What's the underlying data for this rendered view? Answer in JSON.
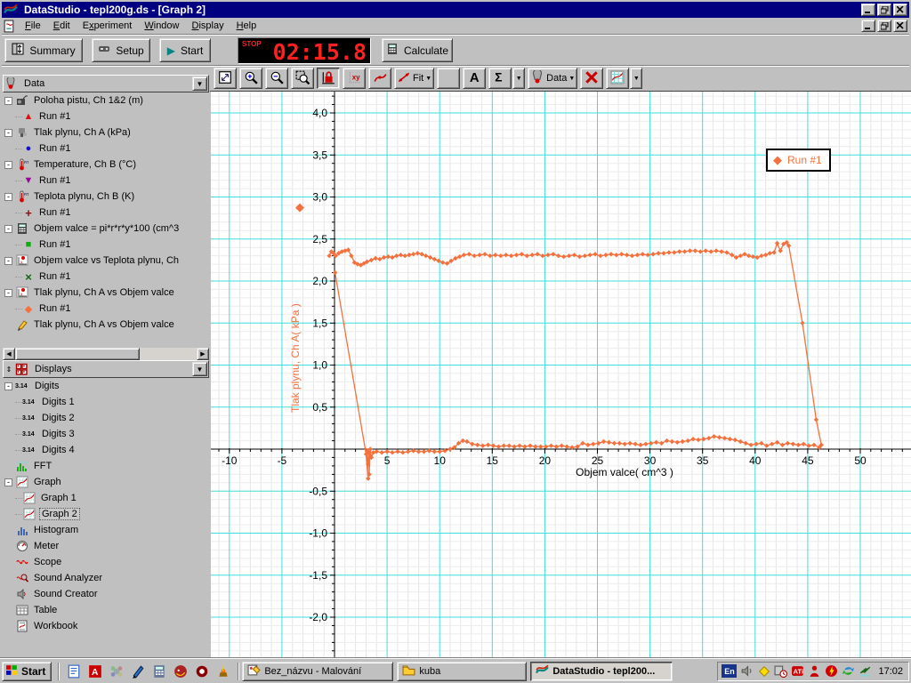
{
  "window": {
    "title": "DataStudio - tepl200g.ds - [Graph 2]"
  },
  "menu": {
    "items": [
      {
        "label": "File",
        "u": 0
      },
      {
        "label": "Edit",
        "u": 0
      },
      {
        "label": "Experiment",
        "u": 1
      },
      {
        "label": "Window",
        "u": 0
      },
      {
        "label": "Display",
        "u": 0
      },
      {
        "label": "Help",
        "u": 0
      }
    ]
  },
  "main_toolbar": {
    "summary_label": "Summary",
    "setup_label": "Setup",
    "start_label": "Start",
    "timer": {
      "stop_label": "STOP",
      "value": "02:15.8"
    },
    "calculate_label": "Calculate"
  },
  "graph_toolbar": {
    "buttons": [
      {
        "name": "scale-to-fit"
      },
      {
        "name": "zoom-in"
      },
      {
        "name": "zoom-out"
      },
      {
        "name": "zoom-select"
      },
      {
        "name": "smart-tool",
        "pressed": true
      },
      {
        "name": "slope-tool"
      },
      {
        "name": "note-tool"
      },
      {
        "name": "fit-menu",
        "label": "Fit",
        "dropdown": true
      },
      {
        "name": "calculator"
      },
      {
        "name": "text-tool"
      },
      {
        "name": "statistics",
        "split": true
      },
      {
        "name": "data-menu",
        "label": "Data",
        "dropdown": true
      },
      {
        "name": "delete"
      },
      {
        "name": "graph-settings",
        "split": true
      }
    ]
  },
  "data_panel": {
    "title": "Data",
    "items": [
      {
        "icon": "motion-sensor-icon",
        "label": "Poloha pistu, Ch 1&2 (m)",
        "run": {
          "glyph": "▲",
          "color": "#dd1111",
          "label": "Run #1"
        }
      },
      {
        "icon": "pressure-sensor-icon",
        "label": "Tlak plynu, Ch A (kPa)",
        "run": {
          "glyph": "●",
          "color": "#1111cc",
          "label": "Run #1"
        }
      },
      {
        "icon": "temperature-sensor-icon",
        "label": "Temperature, Ch B (°C)",
        "run": {
          "glyph": "▼",
          "color": "#990099",
          "label": "Run #1"
        }
      },
      {
        "icon": "temperature-sensor-icon",
        "label": "Teplota plynu, Ch B (K)",
        "run": {
          "glyph": "+",
          "color": "#881111",
          "label": "Run #1"
        }
      },
      {
        "icon": "calculator-icon",
        "label": "Objem valce = pi*r*r*y*100 (cm^3",
        "run": {
          "glyph": "■",
          "color": "#11aa11",
          "label": "Run #1"
        }
      },
      {
        "icon": "xy-graph-icon",
        "label": "Objem valce vs Teplota plynu, Ch",
        "run": {
          "glyph": "×",
          "color": "#116611",
          "label": "Run #1"
        }
      },
      {
        "icon": "xy-graph-icon",
        "label": "Tlak plynu, Ch A vs Objem valce",
        "run": {
          "glyph": "◆",
          "color": "#f4713d",
          "label": "Run #1"
        }
      },
      {
        "icon": "pencil-icon",
        "label": "Tlak plynu, Ch A vs Objem valce",
        "run": null
      }
    ]
  },
  "displays_panel": {
    "title": "Displays",
    "items": [
      {
        "icon": "digits-icon",
        "label": "Digits",
        "children": [
          {
            "icon": "digits-icon",
            "label": "Digits 1"
          },
          {
            "icon": "digits-icon",
            "label": "Digits 2"
          },
          {
            "icon": "digits-icon",
            "label": "Digits 3"
          },
          {
            "icon": "digits-icon",
            "label": "Digits 4"
          }
        ]
      },
      {
        "icon": "fft-icon",
        "label": "FFT"
      },
      {
        "icon": "graph-icon",
        "label": "Graph",
        "children": [
          {
            "icon": "graph-icon",
            "label": "Graph 1"
          },
          {
            "icon": "graph-icon",
            "label": "Graph 2",
            "selected": true
          }
        ]
      },
      {
        "icon": "histogram-icon",
        "label": "Histogram"
      },
      {
        "icon": "meter-icon",
        "label": "Meter"
      },
      {
        "icon": "scope-icon",
        "label": "Scope"
      },
      {
        "icon": "sound-analyzer-icon",
        "label": "Sound Analyzer"
      },
      {
        "icon": "sound-creator-icon",
        "label": "Sound Creator"
      },
      {
        "icon": "table-icon",
        "label": "Table"
      },
      {
        "icon": "workbook-icon",
        "label": "Workbook"
      }
    ]
  },
  "chart_data": {
    "type": "scatter",
    "title": "",
    "xlabel": "Objem valce( cm^3 )",
    "ylabel": "Tlak plynu, Ch A( kPa )",
    "xlim": [
      -11.8,
      54.8
    ],
    "ylim": [
      -2.49,
      4.25
    ],
    "xticks": [
      -10,
      -5,
      5,
      10,
      15,
      20,
      25,
      30,
      35,
      40,
      45,
      50
    ],
    "yticks": [
      4.0,
      3.5,
      3.0,
      2.5,
      2.0,
      1.5,
      1.0,
      0.5,
      -0.5,
      -1.0,
      -1.5,
      -2.0
    ],
    "grid": true,
    "grid_major_color": "#3fdede",
    "grid_minor_color": "#e6e6e6",
    "legend_position": "top-right",
    "series": [
      {
        "name": "Run #1",
        "marker": "diamond",
        "color": "#f4713d",
        "points": [
          [
            -0.5,
            2.3
          ],
          [
            -0.3,
            2.35
          ],
          [
            -0.1,
            2.33
          ],
          [
            0.1,
            2.3
          ],
          [
            0.4,
            2.33
          ],
          [
            0.7,
            2.35
          ],
          [
            1.0,
            2.36
          ],
          [
            1.3,
            2.37
          ],
          [
            1.6,
            2.3
          ],
          [
            1.9,
            2.22
          ],
          [
            2.2,
            2.2
          ],
          [
            2.5,
            2.19
          ],
          [
            2.8,
            2.21
          ],
          [
            3.1,
            2.23
          ],
          [
            3.5,
            2.25
          ],
          [
            3.9,
            2.27
          ],
          [
            4.3,
            2.26
          ],
          [
            4.7,
            2.28
          ],
          [
            5.1,
            2.29
          ],
          [
            5.5,
            2.28
          ],
          [
            5.9,
            2.3
          ],
          [
            6.3,
            2.31
          ],
          [
            6.7,
            2.3
          ],
          [
            7.1,
            2.31
          ],
          [
            7.5,
            2.32
          ],
          [
            7.9,
            2.33
          ],
          [
            8.3,
            2.32
          ],
          [
            8.7,
            2.3
          ],
          [
            9.1,
            2.28
          ],
          [
            9.5,
            2.26
          ],
          [
            9.9,
            2.24
          ],
          [
            10.3,
            2.22
          ],
          [
            10.7,
            2.21
          ],
          [
            11.1,
            2.24
          ],
          [
            11.5,
            2.27
          ],
          [
            11.9,
            2.29
          ],
          [
            12.3,
            2.31
          ],
          [
            12.8,
            2.32
          ],
          [
            13.3,
            2.3
          ],
          [
            13.8,
            2.31
          ],
          [
            14.3,
            2.32
          ],
          [
            14.8,
            2.3
          ],
          [
            15.3,
            2.31
          ],
          [
            15.8,
            2.3
          ],
          [
            16.3,
            2.31
          ],
          [
            16.8,
            2.3
          ],
          [
            17.3,
            2.31
          ],
          [
            17.8,
            2.32
          ],
          [
            18.3,
            2.3
          ],
          [
            18.8,
            2.31
          ],
          [
            19.3,
            2.32
          ],
          [
            19.8,
            2.3
          ],
          [
            20.3,
            2.31
          ],
          [
            20.8,
            2.32
          ],
          [
            21.3,
            2.3
          ],
          [
            21.8,
            2.29
          ],
          [
            22.3,
            2.3
          ],
          [
            22.8,
            2.31
          ],
          [
            23.3,
            2.29
          ],
          [
            23.8,
            2.3
          ],
          [
            24.3,
            2.31
          ],
          [
            24.8,
            2.32
          ],
          [
            25.3,
            2.3
          ],
          [
            25.8,
            2.31
          ],
          [
            26.3,
            2.32
          ],
          [
            26.8,
            2.31
          ],
          [
            27.3,
            2.32
          ],
          [
            27.8,
            2.31
          ],
          [
            28.3,
            2.3
          ],
          [
            28.8,
            2.31
          ],
          [
            29.3,
            2.32
          ],
          [
            29.8,
            2.31
          ],
          [
            30.3,
            2.32
          ],
          [
            30.8,
            2.33
          ],
          [
            31.3,
            2.33
          ],
          [
            31.8,
            2.34
          ],
          [
            32.3,
            2.34
          ],
          [
            32.8,
            2.35
          ],
          [
            33.3,
            2.35
          ],
          [
            33.8,
            2.36
          ],
          [
            34.3,
            2.36
          ],
          [
            34.8,
            2.35
          ],
          [
            35.3,
            2.36
          ],
          [
            35.8,
            2.35
          ],
          [
            36.3,
            2.36
          ],
          [
            36.8,
            2.35
          ],
          [
            37.3,
            2.34
          ],
          [
            37.8,
            2.31
          ],
          [
            38.2,
            2.28
          ],
          [
            38.6,
            2.3
          ],
          [
            39.0,
            2.32
          ],
          [
            39.4,
            2.3
          ],
          [
            39.8,
            2.29
          ],
          [
            40.2,
            2.28
          ],
          [
            40.6,
            2.3
          ],
          [
            41.0,
            2.31
          ],
          [
            41.4,
            2.33
          ],
          [
            41.8,
            2.34
          ],
          [
            42.1,
            2.45
          ],
          [
            42.4,
            2.36
          ],
          [
            42.7,
            2.44
          ],
          [
            43.0,
            2.46
          ],
          [
            43.2,
            2.42
          ],
          [
            44.5,
            1.5
          ],
          [
            45.8,
            0.35
          ],
          [
            46.3,
            0.05
          ],
          [
            46.1,
            0.02
          ],
          [
            45.6,
            0.05
          ],
          [
            45.1,
            0.04
          ],
          [
            44.6,
            0.06
          ],
          [
            44.1,
            0.05
          ],
          [
            43.6,
            0.06
          ],
          [
            43.1,
            0.07
          ],
          [
            42.6,
            0.05
          ],
          [
            42.1,
            0.08
          ],
          [
            41.6,
            0.06
          ],
          [
            41.1,
            0.04
          ],
          [
            40.6,
            0.07
          ],
          [
            40.1,
            0.06
          ],
          [
            39.6,
            0.05
          ],
          [
            39.1,
            0.07
          ],
          [
            38.6,
            0.09
          ],
          [
            38.1,
            0.11
          ],
          [
            37.6,
            0.12
          ],
          [
            37.1,
            0.13
          ],
          [
            36.6,
            0.14
          ],
          [
            36.1,
            0.15
          ],
          [
            35.6,
            0.13
          ],
          [
            35.1,
            0.12
          ],
          [
            34.6,
            0.11
          ],
          [
            34.1,
            0.12
          ],
          [
            33.6,
            0.1
          ],
          [
            33.1,
            0.09
          ],
          [
            32.6,
            0.08
          ],
          [
            32.1,
            0.09
          ],
          [
            31.6,
            0.1
          ],
          [
            31.1,
            0.07
          ],
          [
            30.6,
            0.08
          ],
          [
            30.1,
            0.07
          ],
          [
            29.6,
            0.06
          ],
          [
            29.1,
            0.05
          ],
          [
            28.6,
            0.06
          ],
          [
            28.1,
            0.07
          ],
          [
            27.6,
            0.06
          ],
          [
            27.1,
            0.07
          ],
          [
            26.6,
            0.07
          ],
          [
            26.1,
            0.08
          ],
          [
            25.6,
            0.09
          ],
          [
            25.1,
            0.07
          ],
          [
            24.6,
            0.06
          ],
          [
            24.1,
            0.05
          ],
          [
            23.6,
            0.07
          ],
          [
            23.1,
            0.03
          ],
          [
            22.6,
            0.02
          ],
          [
            22.1,
            0.03
          ],
          [
            21.6,
            0.04
          ],
          [
            21.1,
            0.03
          ],
          [
            20.6,
            0.04
          ],
          [
            20.1,
            0.03
          ],
          [
            19.6,
            0.03
          ],
          [
            19.1,
            0.03
          ],
          [
            18.6,
            0.04
          ],
          [
            18.1,
            0.03
          ],
          [
            17.6,
            0.04
          ],
          [
            17.1,
            0.03
          ],
          [
            16.6,
            0.04
          ],
          [
            16.1,
            0.04
          ],
          [
            15.6,
            0.03
          ],
          [
            15.1,
            0.04
          ],
          [
            14.6,
            0.05
          ],
          [
            14.1,
            0.04
          ],
          [
            13.6,
            0.05
          ],
          [
            13.1,
            0.06
          ],
          [
            12.6,
            0.09
          ],
          [
            12.2,
            0.1
          ],
          [
            11.8,
            0.07
          ],
          [
            11.4,
            0.02
          ],
          [
            11.0,
            0.0
          ],
          [
            10.5,
            -0.02
          ],
          [
            10.0,
            -0.03
          ],
          [
            9.5,
            -0.03
          ],
          [
            9.0,
            -0.02
          ],
          [
            8.5,
            -0.03
          ],
          [
            8.0,
            -0.03
          ],
          [
            7.5,
            -0.02
          ],
          [
            7.0,
            -0.03
          ],
          [
            6.5,
            -0.04
          ],
          [
            6.0,
            -0.03
          ],
          [
            5.5,
            -0.04
          ],
          [
            5.0,
            -0.03
          ],
          [
            4.5,
            -0.04
          ],
          [
            4.0,
            -0.03
          ],
          [
            3.7,
            -0.04
          ],
          [
            3.5,
            -0.1
          ],
          [
            3.4,
            0.0
          ],
          [
            3.3,
            -0.3
          ],
          [
            3.3,
            -0.05
          ],
          [
            3.2,
            -0.18
          ],
          [
            3.1,
            -0.02
          ],
          [
            3.2,
            -0.35
          ],
          [
            3.0,
            -0.06
          ],
          [
            0.05,
            2.1
          ]
        ]
      }
    ]
  },
  "graph": {
    "legend": {
      "glyph": "◆",
      "label": "Run #1"
    }
  },
  "taskbar": {
    "start_label": "Start",
    "quick_launch": [
      "notes-icon",
      "acrobat-icon",
      "icq-icon",
      "pen-icon",
      "pocket-calc-icon",
      "dragon-icon",
      "opera-icon",
      "winamp-icon"
    ],
    "tasks": [
      {
        "icon": "paint-icon",
        "label": "Bez_názvu - Malování",
        "active": false,
        "width": 170
      },
      {
        "icon": "folder-icon",
        "label": "kuba",
        "active": false,
        "width": 146
      },
      {
        "icon": "app-icon",
        "label": "DataStudio - tepl200...",
        "active": true,
        "width": 160
      }
    ],
    "tray": {
      "lang": "En",
      "icons": [
        "volume-icon",
        "diamond-icon",
        "scheduler-icon",
        "ati-icon",
        "persona-icon",
        "power-icon",
        "sync-icon",
        "bolt-icon"
      ],
      "time": "17:02"
    }
  }
}
